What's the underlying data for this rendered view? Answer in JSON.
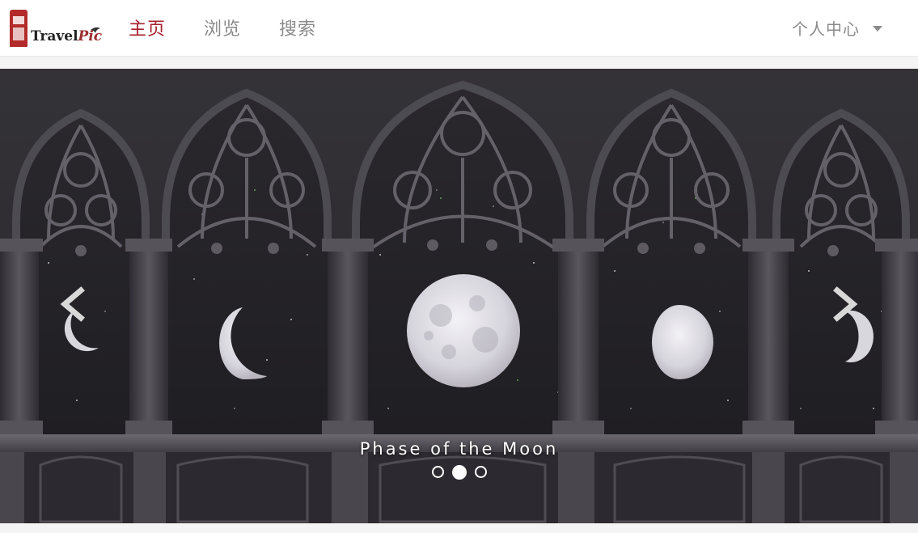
{
  "brand": {
    "name_main": "Travel",
    "name_accent": "Pic"
  },
  "nav": {
    "items": [
      {
        "label": "主页",
        "active": true
      },
      {
        "label": "浏览",
        "active": false
      },
      {
        "label": "搜索",
        "active": false
      }
    ],
    "user_menu_label": "个人中心"
  },
  "carousel": {
    "caption": "Phase of the Moon",
    "slide_count": 3,
    "active_slide": 2
  },
  "colors": {
    "accent": "#a8202d",
    "nav_text": "#8a8a8a"
  }
}
